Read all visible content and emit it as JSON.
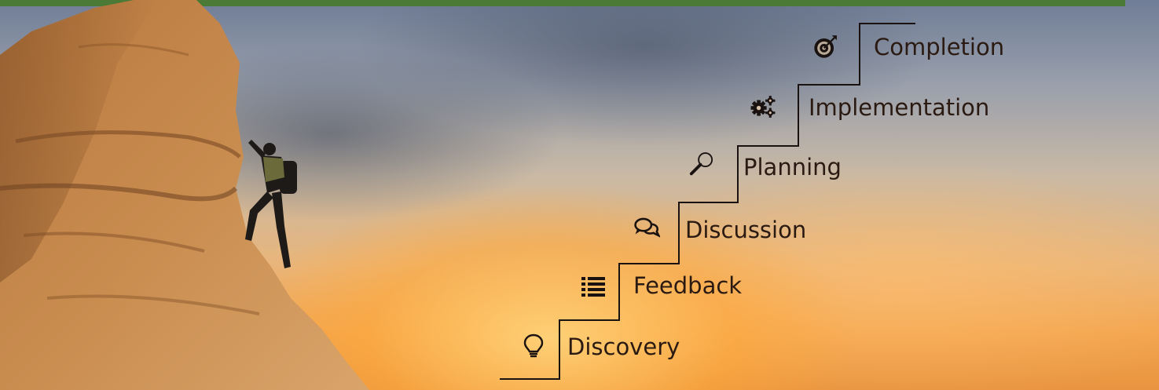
{
  "banner": {
    "accent_color": "#4a7a35",
    "text_color": "#2a1a12"
  },
  "steps": [
    {
      "label": "Discovery",
      "icon": "lightbulb-icon"
    },
    {
      "label": "Feedback",
      "icon": "list-icon"
    },
    {
      "label": "Discussion",
      "icon": "chat-bubbles-icon"
    },
    {
      "label": "Planning",
      "icon": "magnifier-icon"
    },
    {
      "label": "Implementation",
      "icon": "gears-icon"
    },
    {
      "label": "Completion",
      "icon": "target-icon"
    }
  ]
}
